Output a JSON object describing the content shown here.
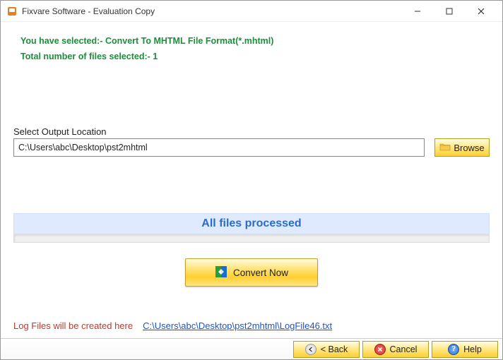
{
  "titlebar": {
    "title": "Fixvare Software - Evaluation Copy"
  },
  "info": {
    "selected": "You have selected:- Convert To MHTML File Format(*.mhtml)",
    "count": "Total number of files selected:- 1"
  },
  "output": {
    "label": "Select Output Location",
    "path": "C:\\Users\\abc\\Desktop\\pst2mhtml"
  },
  "browse": {
    "label": "Browse"
  },
  "status": {
    "text": "All files processed"
  },
  "convert": {
    "label": "Convert Now"
  },
  "log": {
    "label": "Log Files will be created here",
    "path": "C:\\Users\\abc\\Desktop\\pst2mhtml\\LogFile46.txt"
  },
  "footer": {
    "back": "< Back",
    "cancel": "Cancel",
    "help": "Help"
  }
}
